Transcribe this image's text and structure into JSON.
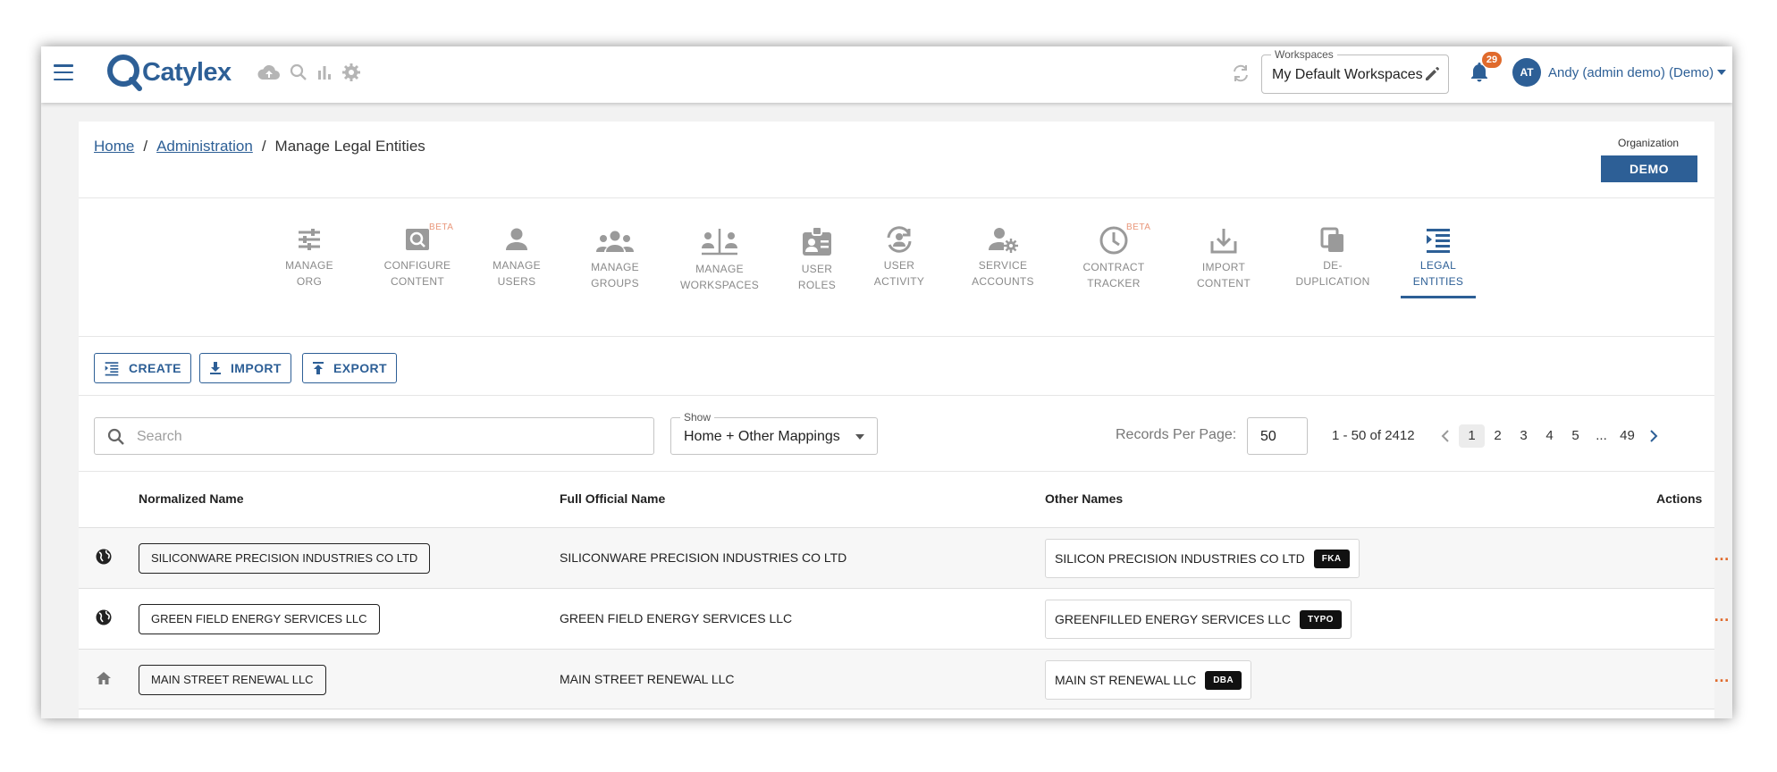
{
  "app": {
    "logo_text": "Catylex",
    "workspaces_label": "Workspaces",
    "workspace_value": "My Default Workspaces",
    "notifications_count": "29",
    "user_initials": "AT",
    "user_name": "Andy (admin demo) (Demo)",
    "toolbar_icons": [
      "cloud-upload-icon",
      "search-icon",
      "bar-chart-icon",
      "gear-icon"
    ]
  },
  "breadcrumb": {
    "home": "Home",
    "sep1": "/",
    "admin": "Administration",
    "sep2": "/",
    "current": "Manage Legal Entities"
  },
  "organization": {
    "label": "Organization",
    "value": "DEMO"
  },
  "nav": [
    {
      "line1": "MANAGE",
      "line2": "ORG",
      "icon": "sliders-icon",
      "beta": ""
    },
    {
      "line1": "CONFIGURE",
      "line2": "CONTENT",
      "icon": "doc-search-icon",
      "beta": "BETA"
    },
    {
      "line1": "MANAGE",
      "line2": "USERS",
      "icon": "person-icon",
      "beta": ""
    },
    {
      "line1": "MANAGE",
      "line2": "GROUPS",
      "icon": "groups-icon",
      "beta": ""
    },
    {
      "line1": "MANAGE",
      "line2": "WORKSPACES",
      "icon": "workspaces-icon",
      "beta": ""
    },
    {
      "line1": "USER",
      "line2": "ROLES",
      "icon": "badge-icon",
      "beta": ""
    },
    {
      "line1": "USER",
      "line2": "ACTIVITY",
      "icon": "activity-icon",
      "beta": ""
    },
    {
      "line1": "SERVICE",
      "line2": "ACCOUNTS",
      "icon": "service-account-icon",
      "beta": ""
    },
    {
      "line1": "CONTRACT",
      "line2": "TRACKER",
      "icon": "clock-icon",
      "beta": "BETA"
    },
    {
      "line1": "IMPORT",
      "line2": "CONTENT",
      "icon": "download-box-icon",
      "beta": ""
    },
    {
      "line1": "DE-",
      "line2": "DUPLICATION",
      "icon": "copy-icon",
      "beta": ""
    },
    {
      "line1": "LEGAL",
      "line2": "ENTITIES",
      "icon": "indent-list-icon",
      "beta": ""
    }
  ],
  "actions": {
    "create": "CREATE",
    "import": "IMPORT",
    "export": "EXPORT"
  },
  "filters": {
    "search_placeholder": "Search",
    "show_label": "Show",
    "show_value": "Home + Other Mappings",
    "records_per_page_label": "Records Per Page:",
    "records_per_page_value": "50",
    "range_text": "1 - 50 of 2412"
  },
  "pagination": {
    "pages": [
      "1",
      "2",
      "3",
      "4",
      "5",
      "...",
      "49"
    ],
    "current": "1"
  },
  "table": {
    "headers": {
      "normalized": "Normalized Name",
      "full": "Full Official Name",
      "other": "Other Names",
      "actions": "Actions"
    },
    "rows": [
      {
        "icon": "globe-icon",
        "normalized": "SILICONWARE PRECISION INDUSTRIES CO LTD",
        "full": "SILICONWARE PRECISION INDUSTRIES CO LTD",
        "other": "SILICON PRECISION INDUSTRIES CO LTD",
        "tag": "FKA",
        "actions": "…"
      },
      {
        "icon": "globe-icon",
        "normalized": "GREEN FIELD ENERGY SERVICES LLC",
        "full": "GREEN FIELD ENERGY SERVICES LLC",
        "other": "GREENFILLED ENERGY SERVICES LLC",
        "tag": "TYPO",
        "actions": "…"
      },
      {
        "icon": "home-icon",
        "normalized": "MAIN STREET RENEWAL LLC",
        "full": "MAIN STREET RENEWAL LLC",
        "other": "MAIN ST RENEWAL LLC",
        "tag": "DBA",
        "actions": "…"
      }
    ]
  },
  "colors": {
    "brand": "#2d5f96",
    "accent": "#e06a2c",
    "beta": "#e9977a",
    "inactive_nav": "#8a8a8a"
  }
}
